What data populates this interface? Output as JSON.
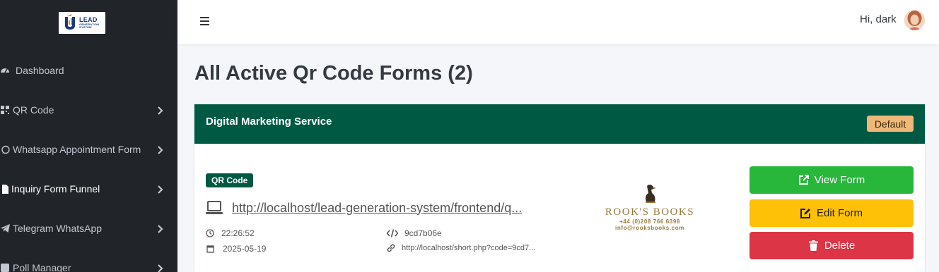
{
  "brand": {
    "line1": "LEAD",
    "line2": "GENERATION",
    "line3": "SYSTEM",
    "colors": {
      "navy": "#1c3a7a",
      "orange": "#f08a1c"
    }
  },
  "sidebar": {
    "items": [
      {
        "label": "Dashboard",
        "icon": "dashboard-icon",
        "has_chevron": false,
        "active": false
      },
      {
        "label": "QR Code",
        "icon": "qrcode-icon",
        "has_chevron": true,
        "active": false
      },
      {
        "label": "Whatsapp Appointment Form",
        "icon": "whatsapp-icon",
        "has_chevron": true,
        "active": false
      },
      {
        "label": "Inquiry Form Funnel",
        "icon": "file-icon",
        "has_chevron": true,
        "active": true
      },
      {
        "label": "Telegram WhatsApp",
        "icon": "telegram-icon",
        "has_chevron": true,
        "active": false
      },
      {
        "label": "Poll Manager",
        "icon": "poll-icon",
        "has_chevron": true,
        "active": false
      }
    ]
  },
  "topbar": {
    "greeting": "Hi, dark"
  },
  "page": {
    "title": "All Active Qr Code Forms (2)"
  },
  "form_card": {
    "title": "Digital Marketing Service",
    "default_badge": "Default",
    "type_badge": "QR Code",
    "url": "http://localhost/lead-generation-system/frontend/q...",
    "time": "22:26:52",
    "date": "2025-05-19",
    "code": "9cd7b06e",
    "short_url": "http://localhost/short.php?code=9cd7...",
    "logo": {
      "name": "ROOK'S BOOKS",
      "phone": "+44 (0)208 766 6398",
      "email": "info@rooksbooks.com"
    },
    "buttons": {
      "view": "View Form",
      "edit": "Edit Form",
      "delete": "Delete"
    }
  },
  "colors": {
    "sidebar_bg": "#212529",
    "header_green": "#005a43",
    "view_green": "#28b63b",
    "edit_yellow": "#ffc107",
    "delete_red": "#dc3545",
    "badge_orange": "#f0b878"
  }
}
